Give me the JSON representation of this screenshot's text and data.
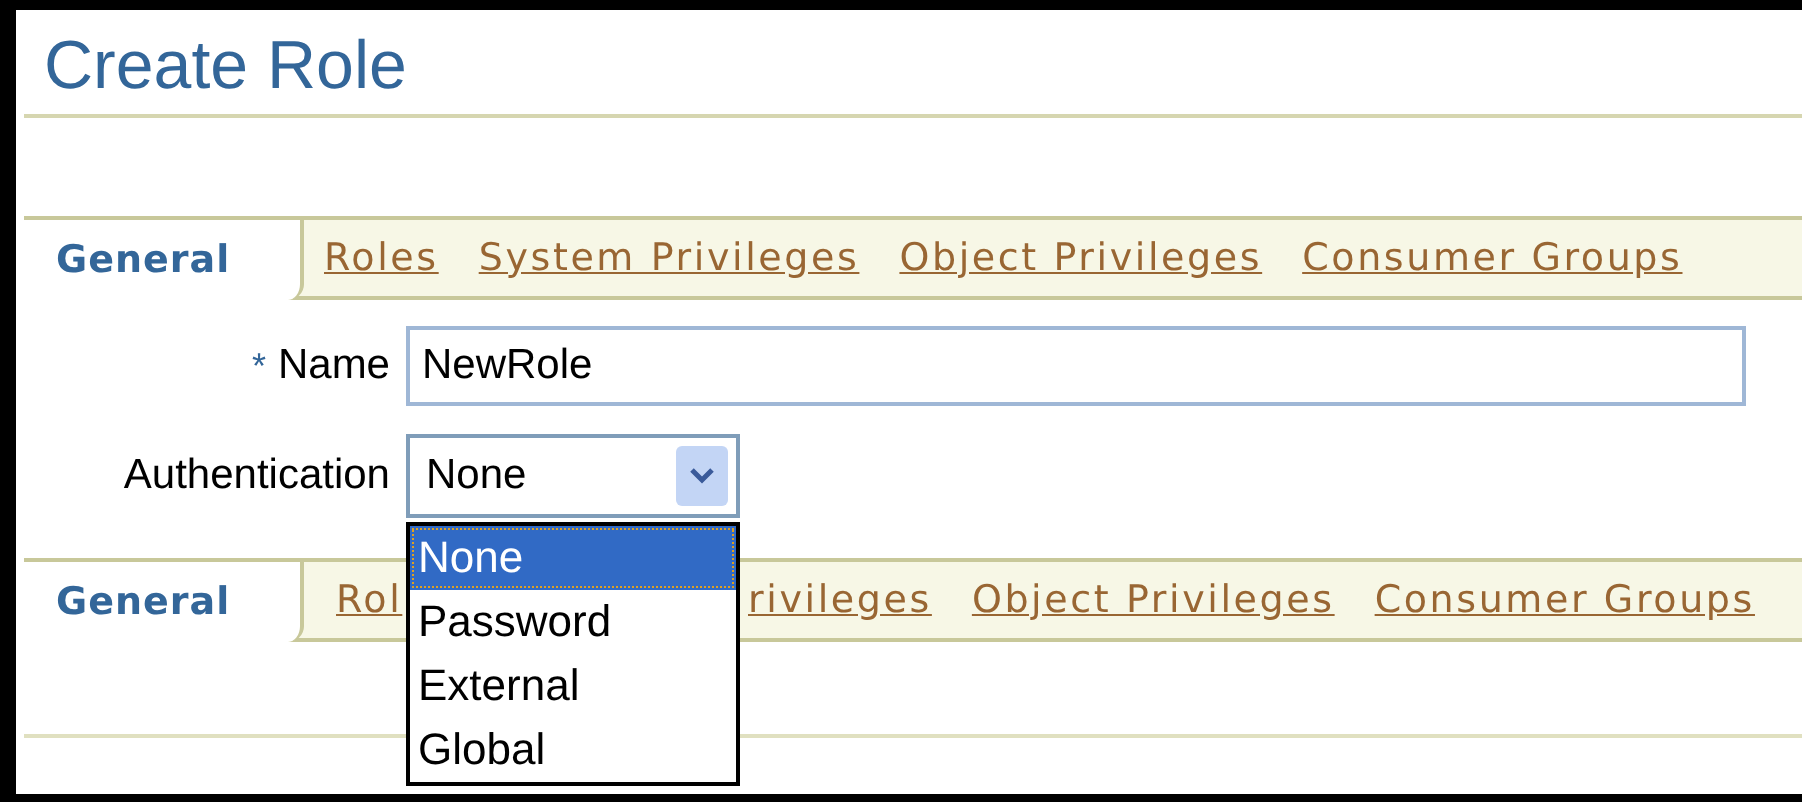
{
  "title": "Create Role",
  "tab_bars": [
    {
      "tabs": [
        {
          "label": "General",
          "selected": true,
          "kind": "full"
        },
        {
          "label": "Roles",
          "selected": false,
          "kind": "full"
        },
        {
          "label": "System Privileges",
          "selected": false,
          "kind": "full"
        },
        {
          "label": "Object Privileges",
          "selected": false,
          "kind": "full"
        },
        {
          "label": "Consumer Groups",
          "selected": false,
          "kind": "full"
        }
      ]
    },
    {
      "tabs": [
        {
          "label": "General",
          "selected": true,
          "kind": "full"
        },
        {
          "label": "Rol",
          "selected": false,
          "kind": "cut_right"
        },
        {
          "label": "rivileges",
          "selected": false,
          "kind": "cut_left"
        },
        {
          "label": "Object Privileges",
          "selected": false,
          "kind": "full"
        },
        {
          "label": "Consumer Groups",
          "selected": false,
          "kind": "full"
        }
      ]
    }
  ],
  "form": {
    "name": {
      "label": "Name",
      "required_mark": "*",
      "value": "NewRole"
    },
    "authentication": {
      "label": "Authentication",
      "value": "None",
      "expanded": true,
      "options": [
        {
          "label": "None",
          "selected": true
        },
        {
          "label": "Password",
          "selected": false
        },
        {
          "label": "External",
          "selected": false
        },
        {
          "label": "Global",
          "selected": false
        }
      ]
    }
  }
}
